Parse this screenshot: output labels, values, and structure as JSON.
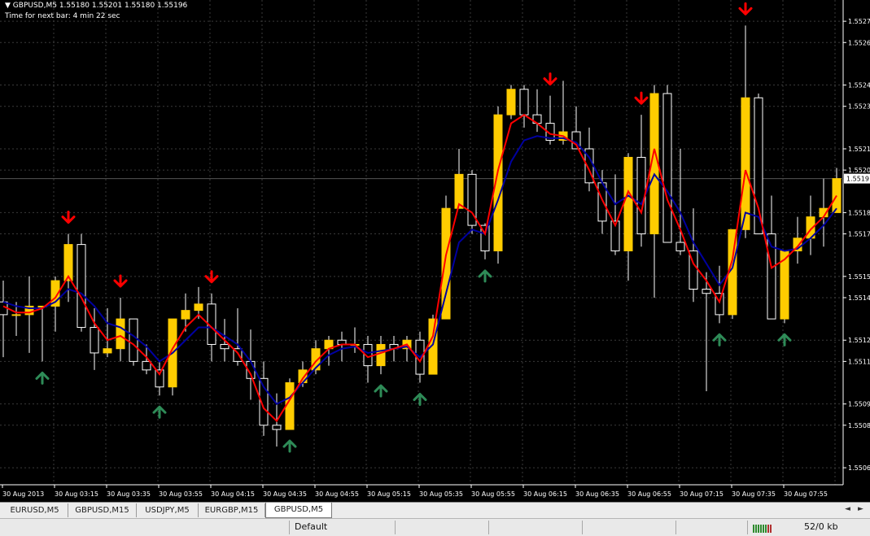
{
  "header": {
    "symbol_line": "GBPUSD,M5  1.55180 1.55201 1.55180 1.55196",
    "timer_line": "Time for next bar: 4 min 22 sec",
    "dropdown_icon": "triangle-down-icon"
  },
  "price_axis": {
    "labels": [
      "1.5527",
      "1.5526",
      "1.5524",
      "1.5523",
      "1.5521",
      "1.5520",
      "1.5518",
      "1.5517",
      "1.5515",
      "1.5514",
      "1.5512",
      "1.5511",
      "1.5509",
      "1.5508",
      "1.5506"
    ],
    "current_price": "1.5519"
  },
  "time_axis": {
    "labels": [
      "30 Aug 2013",
      "30 Aug 03:15",
      "30 Aug 03:35",
      "30 Aug 03:55",
      "30 Aug 04:15",
      "30 Aug 04:35",
      "30 Aug 04:55",
      "30 Aug 05:15",
      "30 Aug 05:35",
      "30 Aug 05:55",
      "30 Aug 06:15",
      "30 Aug 06:35",
      "30 Aug 06:55",
      "30 Aug 07:15",
      "30 Aug 07:35",
      "30 Aug 07:55"
    ]
  },
  "colors": {
    "background": "#000000",
    "grid": "#3a3a3a",
    "bull_fill": "#ffcc00",
    "bear_fill": "#000000",
    "candle_outline": "#ffffff",
    "ma_fast": "#ff0000",
    "ma_slow": "#0000a0",
    "arrow_up": "#2e8b57",
    "arrow_down": "#ff0000"
  },
  "chart_data": {
    "type": "candlestick",
    "symbol": "GBPUSD",
    "timeframe": "M5",
    "ylim": [
      1.55052,
      1.5528
    ],
    "candles": [
      [
        1.55138,
        1.55148,
        1.55112,
        1.55132
      ],
      [
        1.55132,
        1.55138,
        1.55122,
        1.55132
      ],
      [
        1.55132,
        1.5515,
        1.55114,
        1.55136
      ],
      [
        1.55136,
        1.55135,
        1.5511,
        1.55136
      ],
      [
        1.55136,
        1.5515,
        1.55124,
        1.55148
      ],
      [
        1.55148,
        1.5517,
        1.55138,
        1.55165
      ],
      [
        1.55165,
        1.5517,
        1.55124,
        1.55126
      ],
      [
        1.55126,
        1.55135,
        1.55106,
        1.55114
      ],
      [
        1.55114,
        1.55135,
        1.55112,
        1.55116
      ],
      [
        1.55116,
        1.5514,
        1.5511,
        1.5513
      ],
      [
        1.5513,
        1.5513,
        1.55108,
        1.5511
      ],
      [
        1.5511,
        1.55118,
        1.55104,
        1.55106
      ],
      [
        1.55106,
        1.5511,
        1.55094,
        1.55098
      ],
      [
        1.55098,
        1.5513,
        1.55094,
        1.5513
      ],
      [
        1.5513,
        1.55142,
        1.55124,
        1.55134
      ],
      [
        1.55134,
        1.55145,
        1.5513,
        1.55137
      ],
      [
        1.55137,
        1.55142,
        1.5511,
        1.55118
      ],
      [
        1.55118,
        1.5513,
        1.5511,
        1.55116
      ],
      [
        1.55116,
        1.55135,
        1.55108,
        1.5511
      ],
      [
        1.5511,
        1.55125,
        1.55092,
        1.55102
      ],
      [
        1.55102,
        1.5511,
        1.55075,
        1.5508
      ],
      [
        1.5508,
        1.55095,
        1.5507,
        1.55078
      ],
      [
        1.55078,
        1.55102,
        1.55078,
        1.551
      ],
      [
        1.551,
        1.5511,
        1.55098,
        1.55106
      ],
      [
        1.55106,
        1.5512,
        1.55104,
        1.55116
      ],
      [
        1.55116,
        1.55122,
        1.55108,
        1.5512
      ],
      [
        1.5512,
        1.55124,
        1.5511,
        1.55118
      ],
      [
        1.55118,
        1.55126,
        1.55114,
        1.55118
      ],
      [
        1.55118,
        1.55122,
        1.551,
        1.55108
      ],
      [
        1.55108,
        1.55122,
        1.55104,
        1.55118
      ],
      [
        1.55118,
        1.55122,
        1.5511,
        1.55116
      ],
      [
        1.55116,
        1.55122,
        1.5511,
        1.5512
      ],
      [
        1.5512,
        1.55124,
        1.551,
        1.55104
      ],
      [
        1.55104,
        1.55132,
        1.55104,
        1.5513
      ],
      [
        1.5513,
        1.55188,
        1.5513,
        1.55182
      ],
      [
        1.55182,
        1.5521,
        1.55182,
        1.55198
      ],
      [
        1.55198,
        1.552,
        1.5517,
        1.55174
      ],
      [
        1.55174,
        1.55175,
        1.55158,
        1.55162
      ],
      [
        1.55162,
        1.5523,
        1.55156,
        1.55226
      ],
      [
        1.55226,
        1.5524,
        1.55224,
        1.55238
      ],
      [
        1.55238,
        1.5524,
        1.5522,
        1.55226
      ],
      [
        1.55226,
        1.55238,
        1.55218,
        1.55222
      ],
      [
        1.55222,
        1.55235,
        1.55212,
        1.55214
      ],
      [
        1.55214,
        1.55242,
        1.55212,
        1.55218
      ],
      [
        1.55218,
        1.5523,
        1.5521,
        1.5521
      ],
      [
        1.5521,
        1.5522,
        1.5519,
        1.55194
      ],
      [
        1.55194,
        1.552,
        1.5517,
        1.55176
      ],
      [
        1.55176,
        1.55198,
        1.5516,
        1.55162
      ],
      [
        1.55162,
        1.55208,
        1.55148,
        1.55206
      ],
      [
        1.55206,
        1.55226,
        1.55164,
        1.5517
      ],
      [
        1.5517,
        1.5524,
        1.5514,
        1.55236
      ],
      [
        1.55236,
        1.5524,
        1.55166,
        1.55166
      ],
      [
        1.55166,
        1.5521,
        1.5516,
        1.55162
      ],
      [
        1.55162,
        1.55182,
        1.55138,
        1.55144
      ],
      [
        1.55144,
        1.55152,
        1.55096,
        1.55142
      ],
      [
        1.55142,
        1.55155,
        1.55128,
        1.55132
      ],
      [
        1.55132,
        1.55172,
        1.5513,
        1.55172
      ],
      [
        1.55172,
        1.55268,
        1.55168,
        1.55234
      ],
      [
        1.55234,
        1.55236,
        1.5517,
        1.5517
      ],
      [
        1.5517,
        1.55188,
        1.5513,
        1.5513
      ],
      [
        1.5513,
        1.55162,
        1.55128,
        1.55162
      ],
      [
        1.55162,
        1.55178,
        1.55156,
        1.55168
      ],
      [
        1.55168,
        1.55188,
        1.5516,
        1.55178
      ],
      [
        1.55178,
        1.55196,
        1.55164,
        1.55182
      ],
      [
        1.5518,
        1.55201,
        1.5518,
        1.55196
      ]
    ],
    "ma_fast": [
      1.55136,
      1.55133,
      1.55133,
      1.55135,
      1.5514,
      1.5515,
      1.5514,
      1.55128,
      1.5512,
      1.55122,
      1.55118,
      1.55112,
      1.55104,
      1.55116,
      1.55126,
      1.55132,
      1.55126,
      1.5512,
      1.55114,
      1.55104,
      1.55088,
      1.55082,
      1.55092,
      1.55102,
      1.5511,
      1.55116,
      1.55118,
      1.55118,
      1.55112,
      1.55114,
      1.55116,
      1.55118,
      1.5511,
      1.55122,
      1.5516,
      1.55184,
      1.5518,
      1.5517,
      1.552,
      1.55222,
      1.55226,
      1.55222,
      1.55217,
      1.55216,
      1.55212,
      1.552,
      1.55186,
      1.55174,
      1.5519,
      1.5518,
      1.5521,
      1.55186,
      1.55172,
      1.55156,
      1.55148,
      1.55138,
      1.55158,
      1.552,
      1.55182,
      1.55154,
      1.55158,
      1.55164,
      1.55172,
      1.55178,
      1.55188
    ],
    "ma_slow": [
      1.55138,
      1.55136,
      1.55135,
      1.55135,
      1.55138,
      1.55144,
      1.55142,
      1.55136,
      1.55128,
      1.55126,
      1.55122,
      1.55117,
      1.5511,
      1.55114,
      1.5512,
      1.55126,
      1.55126,
      1.55122,
      1.55118,
      1.5511,
      1.55098,
      1.5509,
      1.55093,
      1.551,
      1.55107,
      1.55113,
      1.55116,
      1.55117,
      1.55114,
      1.55115,
      1.55116,
      1.55117,
      1.55112,
      1.55118,
      1.55142,
      1.55166,
      1.55172,
      1.5517,
      1.55186,
      1.55204,
      1.55214,
      1.55216,
      1.55215,
      1.55215,
      1.55213,
      1.55206,
      1.55194,
      1.55184,
      1.55188,
      1.55184,
      1.55198,
      1.5519,
      1.5518,
      1.55166,
      1.55156,
      1.55146,
      1.55154,
      1.5518,
      1.55178,
      1.55164,
      1.55162,
      1.55163,
      1.55168,
      1.55174,
      1.55182
    ],
    "signals": [
      {
        "index": 3,
        "dir": "up"
      },
      {
        "index": 5,
        "dir": "down"
      },
      {
        "index": 9,
        "dir": "down"
      },
      {
        "index": 12,
        "dir": "up"
      },
      {
        "index": 16,
        "dir": "down"
      },
      {
        "index": 22,
        "dir": "up"
      },
      {
        "index": 29,
        "dir": "up"
      },
      {
        "index": 32,
        "dir": "up"
      },
      {
        "index": 37,
        "dir": "up"
      },
      {
        "index": 42,
        "dir": "down"
      },
      {
        "index": 49,
        "dir": "down"
      },
      {
        "index": 55,
        "dir": "up"
      },
      {
        "index": 57,
        "dir": "down"
      },
      {
        "index": 60,
        "dir": "up"
      }
    ]
  },
  "tabs": [
    {
      "label": "EURUSD,M5",
      "active": false
    },
    {
      "label": "GBPUSD,M15",
      "active": false
    },
    {
      "label": "USDJPY,M5",
      "active": false
    },
    {
      "label": "EURGBP,M15",
      "active": false
    },
    {
      "label": "GBPUSD,M5",
      "active": true
    }
  ],
  "tab_nav": {
    "left": "◄",
    "right": "►"
  },
  "status": {
    "profile": "Default",
    "traffic": "52/0 kb",
    "traffic_icon": "connection-bars-icon"
  }
}
